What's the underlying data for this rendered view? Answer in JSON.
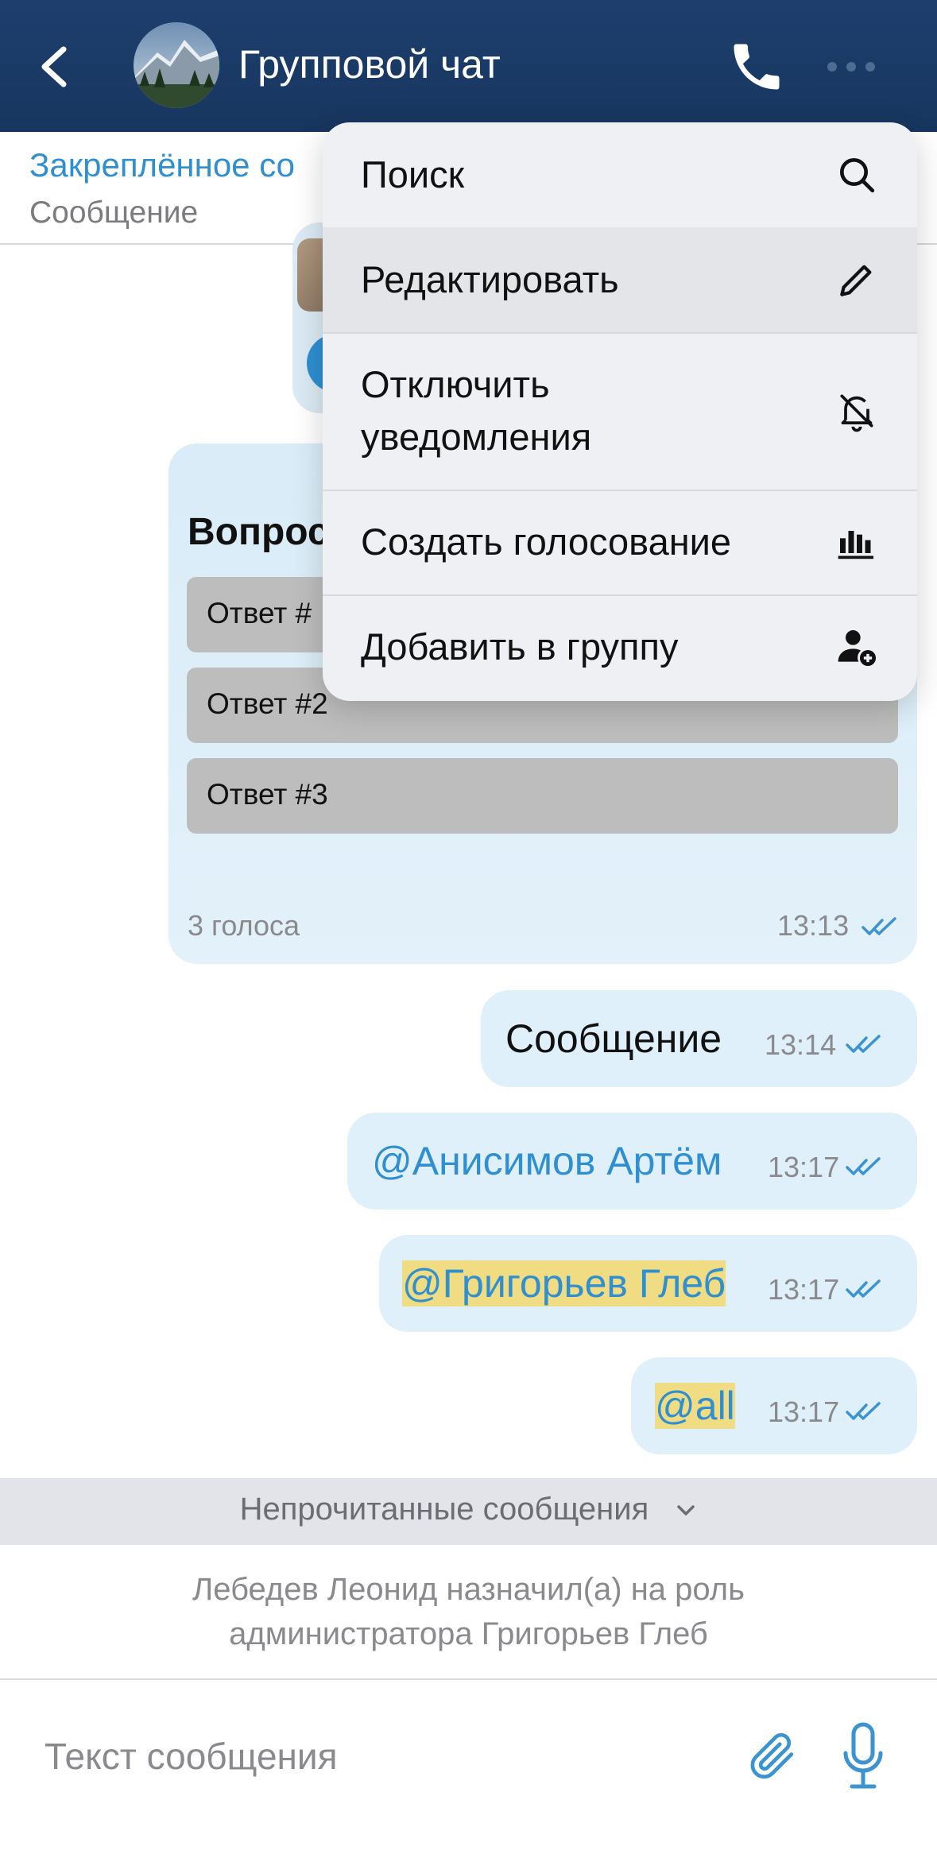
{
  "header": {
    "title": "Групповой чат"
  },
  "pinned": {
    "title": "Закреплённое со",
    "subtitle": "Сообщение"
  },
  "poll": {
    "question": "Вопрос",
    "options": [
      "Ответ #1",
      "Ответ #2",
      "Ответ #3"
    ],
    "visible_option_1": "Ответ #",
    "votes": "3 голоса",
    "time": "13:13"
  },
  "messages": [
    {
      "text": "Сообщение",
      "time": "13:14"
    },
    {
      "text": "@Анисимов Артём",
      "time": "13:17"
    },
    {
      "text": "@Григорьев Глеб",
      "time": "13:17"
    },
    {
      "text": "@all",
      "time": "13:17"
    }
  ],
  "unread_divider": {
    "label": "Непрочитанные сообщения"
  },
  "system_message": {
    "line1": "Лебедев Леонид назначил(а) на роль",
    "line2": "администратора Григорьев Глеб"
  },
  "composer": {
    "placeholder": "Текст сообщения"
  },
  "menu": {
    "items": [
      {
        "label": "Поиск",
        "icon": "search-icon"
      },
      {
        "label": "Редактировать",
        "icon": "pencil-icon"
      },
      {
        "label_line1": "Отключить",
        "label_line2": "уведомления",
        "icon": "bell-off-icon"
      },
      {
        "label": "Создать голосование",
        "icon": "poll-chart-icon"
      },
      {
        "label": "Добавить в группу",
        "icon": "add-user-icon"
      }
    ]
  },
  "colors": {
    "header_bg": "#1e3f6e",
    "accent": "#2f8fd0",
    "bubble_bg": "#dff0fa",
    "mention_highlight": "#f0dc82",
    "menu_bg": "#eef0f3"
  }
}
